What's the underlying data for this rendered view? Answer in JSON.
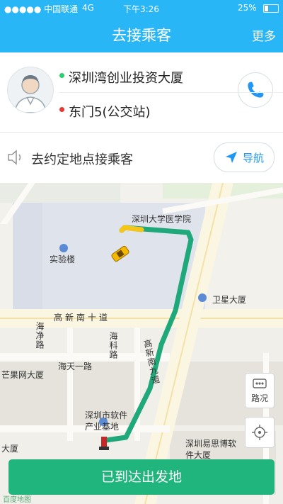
{
  "status_bar": {
    "carrier": "●●●●● 中国联通",
    "network": "4G",
    "time": "下午3:26",
    "battery": "25%"
  },
  "nav": {
    "title": "去接乘客",
    "more": "更多"
  },
  "trip": {
    "pickup": "深圳湾创业投资大厦",
    "dropoff": "东门5(公交站)",
    "pickup_color": "#2ecc71",
    "dropoff_color": "#e53935"
  },
  "info": {
    "text": "去约定地点接乘客",
    "nav_button": "导航"
  },
  "map": {
    "labels": {
      "medical_college": "深圳大学医学院",
      "lab_building": "实验楼",
      "satellite_building": "卫星大厦",
      "gaoxin_south_10": "高新南十道",
      "haijing_road": "海净路",
      "haike_road": "海科路",
      "haitian_1": "海天一路",
      "mangguo_building": "芒果网大厦",
      "gaoxin_south_9": "高新南九道",
      "software_base": "深圳市软件产业基地",
      "yisi_building": "深圳易思博软件大厦",
      "dasha": "大厦",
      "traffic": "路况"
    },
    "colors": {
      "route": "#1fa87a",
      "route_start": "#f5c518",
      "block": "#dfe3ec"
    },
    "logo": "百度地图"
  },
  "action": {
    "label": "已到达出发地",
    "color": "#1fb57c"
  }
}
